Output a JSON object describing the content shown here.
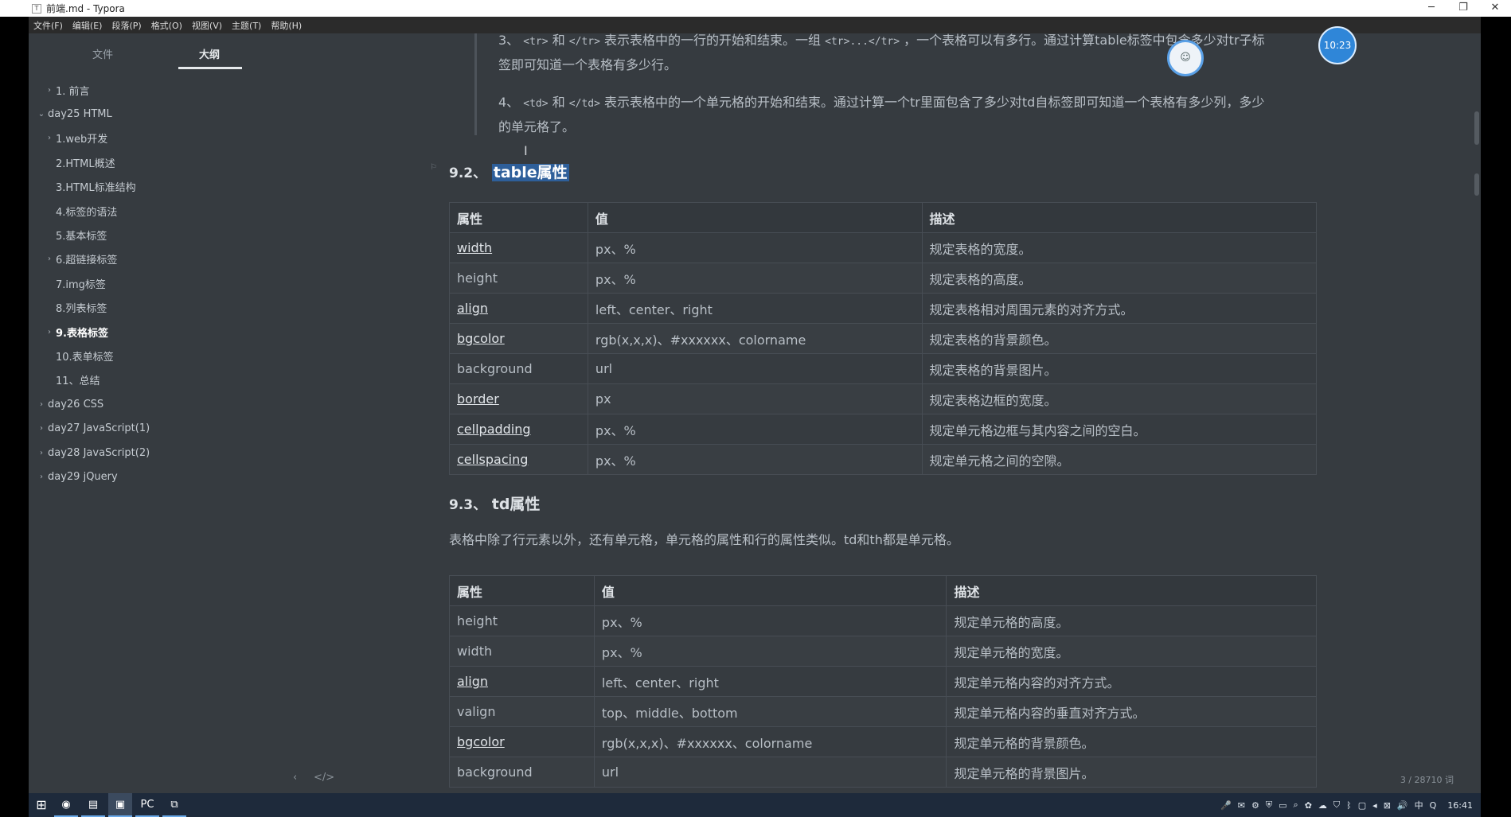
{
  "window": {
    "title": "前端.md - Typora",
    "controls": {
      "minimize": "─",
      "restore": "❐",
      "close": "✕"
    }
  },
  "menu": [
    "文件(F)",
    "编辑(E)",
    "段落(P)",
    "格式(O)",
    "视图(V)",
    "主题(T)",
    "帮助(H)"
  ],
  "sidebar": {
    "tabs": [
      "文件",
      "大纲"
    ],
    "active_tab": "大纲",
    "outline": [
      {
        "label": "1. 前言",
        "level": 2,
        "chevron": "›"
      },
      {
        "label": "day25 HTML",
        "level": 1,
        "chevron": "⌄"
      },
      {
        "label": "1.web开发",
        "level": 2,
        "chevron": "›"
      },
      {
        "label": "2.HTML概述",
        "level": 2,
        "chevron": ""
      },
      {
        "label": "3.HTML标准结构",
        "level": 2,
        "chevron": ""
      },
      {
        "label": "4.标签的语法",
        "level": 2,
        "chevron": ""
      },
      {
        "label": "5.基本标签",
        "level": 2,
        "chevron": ""
      },
      {
        "label": "6.超链接标签",
        "level": 2,
        "chevron": "›"
      },
      {
        "label": "7.img标签",
        "level": 2,
        "chevron": ""
      },
      {
        "label": "8.列表标签",
        "level": 2,
        "chevron": ""
      },
      {
        "label": "9.表格标签",
        "level": 2,
        "chevron": "›",
        "active": true
      },
      {
        "label": "10.表单标签",
        "level": 2,
        "chevron": ""
      },
      {
        "label": "11、总结",
        "level": 2,
        "chevron": ""
      },
      {
        "label": "day26 CSS",
        "level": 1,
        "chevron": "›"
      },
      {
        "label": "day27 JavaScript(1)",
        "level": 1,
        "chevron": "›"
      },
      {
        "label": "day28 JavaScript(2)",
        "level": 1,
        "chevron": "›"
      },
      {
        "label": "day29 jQuery",
        "level": 1,
        "chevron": "›"
      }
    ]
  },
  "editor": {
    "item3": {
      "prefix": "3、",
      "code1": "<tr>",
      "and": "和",
      "code2": "</tr>",
      "text1": "表示表格中的一行的开始和结束。一组",
      "code3": "<tr>...</tr>",
      "text2": "，一个表格可以有多行。通过计算table标签中包含多少对tr子标",
      "line2": "签即可知道一个表格有多少行。"
    },
    "item4": {
      "prefix": "4、",
      "code1": "<td>",
      "and": "和",
      "code2": "</td>",
      "text1": "表示表格中的一个单元格的开始和结束。通过计算一个tr里面包含了多少对td自标签即可知道一个表格有多少列，多少",
      "line2": "的单元格了。"
    },
    "h92": {
      "num": "9.2、",
      "title": "table属性"
    },
    "table1": {
      "headers": [
        "属性",
        "值",
        "描述"
      ],
      "rows": [
        {
          "attr": "width",
          "value": "px、%",
          "desc": "规定表格的宽度。",
          "link": true
        },
        {
          "attr": "height",
          "value": "px、%",
          "desc": "规定表格的高度。",
          "link": false
        },
        {
          "attr": "align",
          "value": "left、center、right",
          "desc": "规定表格相对周围元素的对齐方式。",
          "link": true
        },
        {
          "attr": "bgcolor",
          "value": "rgb(x,x,x)、#xxxxxx、colorname",
          "desc": "规定表格的背景颜色。",
          "link": true
        },
        {
          "attr": "background",
          "value": "url",
          "desc": "规定表格的背景图片。",
          "link": false
        },
        {
          "attr": "border",
          "value": "px",
          "desc": "规定表格边框的宽度。",
          "link": true
        },
        {
          "attr": "cellpadding",
          "value": "px、%",
          "desc": "规定单元格边框与其内容之间的空白。",
          "link": true
        },
        {
          "attr": "cellspacing",
          "value": "px、%",
          "desc": "规定单元格之间的空隙。",
          "link": true
        }
      ]
    },
    "h93": {
      "num": "9.3、",
      "title": "td属性"
    },
    "td_paragraph": "表格中除了行元素以外，还有单元格，单元格的属性和行的属性类似。td和th都是单元格。",
    "table2": {
      "headers": [
        "属性",
        "值",
        "描述"
      ],
      "rows": [
        {
          "attr": "height",
          "value": "px、%",
          "desc": "规定单元格的高度。",
          "link": false
        },
        {
          "attr": "width",
          "value": "px、%",
          "desc": "规定单元格的宽度。",
          "link": false
        },
        {
          "attr": "align",
          "value": "left、center、right",
          "desc": "规定单元格内容的对齐方式。",
          "link": true
        },
        {
          "attr": "valign",
          "value": "top、middle、bottom",
          "desc": "规定单元格内容的垂直对齐方式。",
          "link": false
        },
        {
          "attr": "bgcolor",
          "value": "rgb(x,x,x)、#xxxxxx、colorname",
          "desc": "规定单元格的背景颜色。",
          "link": true
        },
        {
          "attr": "background",
          "value": "url",
          "desc": "规定单元格的背景图片。",
          "link": false
        }
      ]
    },
    "word_count": "3 / 28710 词",
    "bottom_icons": {
      "back": "‹",
      "source": "</>"
    }
  },
  "overlays": {
    "clock_bubble": "10:23"
  },
  "taskbar": {
    "start": "⊞",
    "apps": [
      "◉",
      "▤",
      "▣",
      "PC",
      "⧉"
    ],
    "tray_icons": [
      "🎤",
      "✉",
      "⚙",
      "⛨",
      "▭",
      "⌕",
      "✿",
      "☁",
      "⛉",
      "ᛒ",
      "▢",
      "◂",
      "⊠",
      "🔊",
      "中",
      "Q"
    ],
    "time": "16:41"
  },
  "colors": {
    "editor_bg": "#363b40",
    "selection": "#2e5f9a",
    "taskbar": "#1e2a3b"
  }
}
